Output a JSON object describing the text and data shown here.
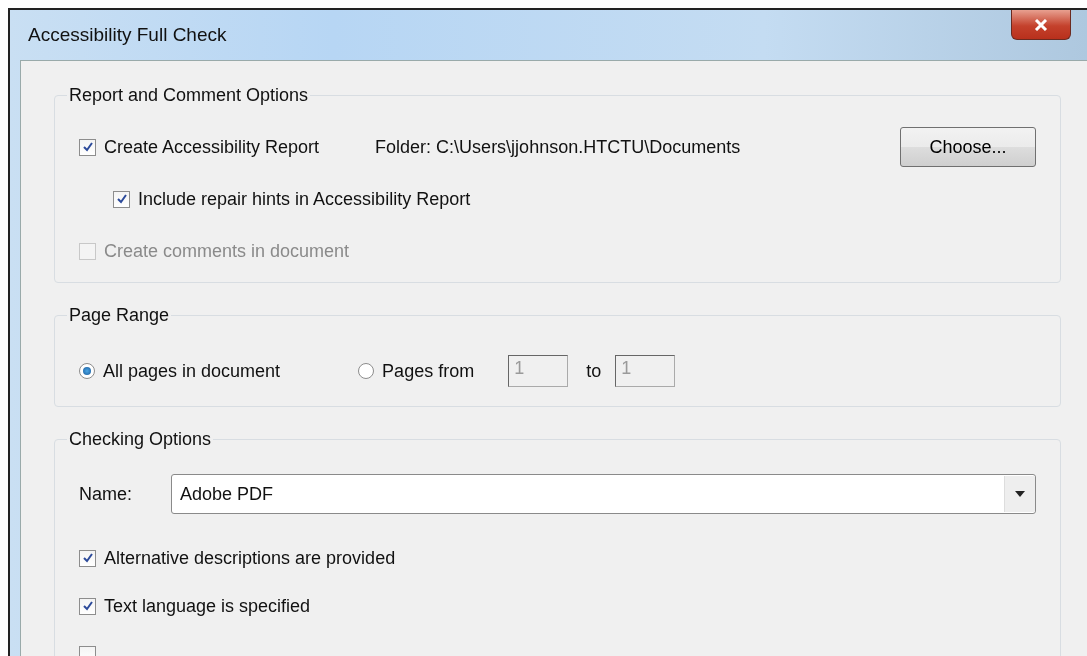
{
  "window": {
    "title": "Accessibility Full Check"
  },
  "report_options": {
    "title": "Report and Comment Options",
    "items": [
      {
        "label": "Create Accessibility Report",
        "checked": true,
        "disabled": false,
        "children": [
          {
            "label": "Include repair hints in Accessibility Report",
            "checked": true,
            "disabled": false
          }
        ]
      },
      {
        "label": "Create comments in document",
        "checked": false,
        "disabled": true
      }
    ],
    "folder": "Folder: C:\\Users\\jjohnson.HTCTU\\Documents",
    "choose_button": "Choose..."
  },
  "page_range": {
    "title": "Page Range",
    "options": [
      {
        "label": "All pages in document",
        "selected": true
      },
      {
        "label": "Pages from",
        "selected": false
      }
    ],
    "from": "1",
    "to_label": "to",
    "to": "1"
  },
  "checking_options": {
    "title": "Checking Options",
    "name_label": "Name:",
    "name_value": "Adobe PDF",
    "items": [
      {
        "label": "Alternative descriptions are provided",
        "checked": true
      },
      {
        "label": "Text language is specified",
        "checked": true
      },
      {
        "checked": false
      }
    ]
  }
}
